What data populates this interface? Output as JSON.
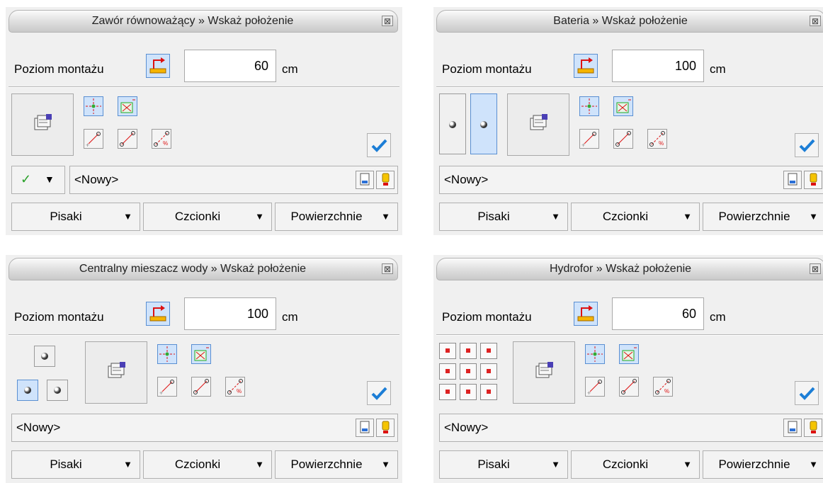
{
  "panels": [
    {
      "title": "Zawór równoważący » Wskaż położenie",
      "poziom_label": "Poziom montażu",
      "level_value": "60",
      "unit": "cm",
      "name": "<Nowy>",
      "dropdowns": [
        "Pisaki",
        "Czcionki",
        "Powierzchnie"
      ]
    },
    {
      "title": "Bateria » Wskaż położenie",
      "poziom_label": "Poziom montażu",
      "level_value": "100",
      "unit": "cm",
      "name": "<Nowy>",
      "dropdowns": [
        "Pisaki",
        "Czcionki",
        "Powierzchnie"
      ]
    },
    {
      "title": "Centralny mieszacz wody » Wskaż położenie",
      "poziom_label": "Poziom montażu",
      "level_value": "100",
      "unit": "cm",
      "name": "<Nowy>",
      "dropdowns": [
        "Pisaki",
        "Czcionki",
        "Powierzchnie"
      ]
    },
    {
      "title": "Hydrofor » Wskaż położenie",
      "poziom_label": "Poziom montażu",
      "level_value": "60",
      "unit": "cm",
      "name": "<Nowy>",
      "dropdowns": [
        "Pisaki",
        "Czcionki",
        "Powierzchnie"
      ]
    }
  ],
  "glyphs": {
    "close": "⊠",
    "check": "✓",
    "ok": "✔",
    "arrow_down": "▼"
  },
  "colors": {
    "selected_bg": "#cfe3fb",
    "selected_border": "#5a8fd2",
    "ok_blue": "#1c7ed6",
    "check_green": "#2aa12a"
  }
}
